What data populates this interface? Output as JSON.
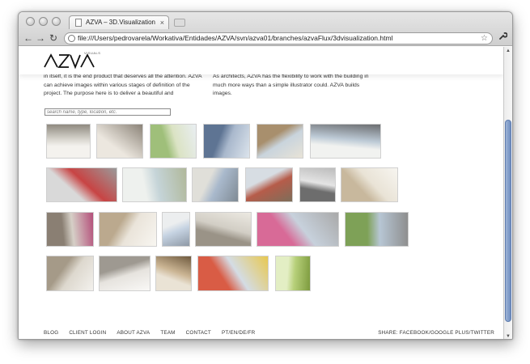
{
  "browser": {
    "tab_title": "AZVA – 3D.Visualization",
    "tab_close": "×",
    "back_glyph": "←",
    "forward_glyph": "→",
    "reload_glyph": "↻",
    "url": "file:///Users/pedrovarela/Workativa/Entidades/AZVA/svn/azva01/branches/azvaFlux/3dvisualization.html",
    "star_glyph": "☆",
    "wrench_glyph": "🔧",
    "scroll_up": "▲",
    "scroll_down": "▼"
  },
  "site": {
    "logo_text": "AZVA",
    "logo_sub": "VISUALS",
    "intro_left": "in itself, it is the end product that deserves all the attention. AZVA can achieve images within various stages of definition of the project. The purpose here is to deliver a beautiful and",
    "intro_right": "As architects, AZVA has the flexibility to work with the building in much more ways than a simple illustrator could. AZVA builds images.",
    "search_placeholder": "search name, type, location, etc.",
    "footer_links": [
      "BLOG",
      "CLIENT LOGIN",
      "ABOUT AZVA",
      "TEAM",
      "CONTACT",
      "PT/EN/DE/FR"
    ],
    "share_text": "SHARE: FACEBOOK/GOOGLE PLUS/TWITTER"
  },
  "gallery": [
    {
      "name": "interior-balcony",
      "colors": [
        "#d9d6cf",
        "#f4f2ee",
        "#8f8a80"
      ]
    },
    {
      "name": "interior-dining",
      "colors": [
        "#cfc9c0",
        "#ece7df",
        "#8b8378"
      ]
    },
    {
      "name": "green-building",
      "colors": [
        "#dbe3c4",
        "#9fbf7a",
        "#e9eef2"
      ]
    },
    {
      "name": "blue-facade",
      "colors": [
        "#a9b8cc",
        "#5e7493",
        "#dce4ec"
      ]
    },
    {
      "name": "street-people",
      "colors": [
        "#c9d4dd",
        "#a88f6d",
        "#e8e3d7"
      ]
    },
    {
      "name": "white-villa-woman",
      "colors": [
        "#bdcad6",
        "#f1f2f0",
        "#6b6d70"
      ]
    },
    {
      "name": "red-interior",
      "colors": [
        "#c84444",
        "#d9d9d9",
        "#9a9a9a"
      ]
    },
    {
      "name": "aerial-landscape",
      "colors": [
        "#c5d4d8",
        "#eef1ee",
        "#b0b89a"
      ]
    },
    {
      "name": "tower-block",
      "colors": [
        "#a9b9cc",
        "#e0dfd9",
        "#7f8a94"
      ]
    },
    {
      "name": "red-brick-building",
      "colors": [
        "#b65c4a",
        "#d7dde3",
        "#7d6e5a"
      ]
    },
    {
      "name": "wireframe-model",
      "colors": [
        "#e4e4e4",
        "#6d6d6d",
        "#bcbcbc"
      ]
    },
    {
      "name": "bright-interior",
      "colors": [
        "#e9e3d6",
        "#c8b89d",
        "#f7f5f0"
      ]
    },
    {
      "name": "woman-atrium",
      "colors": [
        "#d6d0c7",
        "#8a7f73",
        "#b44f7a"
      ]
    },
    {
      "name": "curved-ceiling",
      "colors": [
        "#eae4da",
        "#bba98e",
        "#f8f6f1"
      ]
    },
    {
      "name": "highrise",
      "colors": [
        "#c6d3e2",
        "#eceeef",
        "#8e99a6"
      ]
    },
    {
      "name": "concrete-hall",
      "colors": [
        "#d2cec5",
        "#9a9387",
        "#ece9e2"
      ]
    },
    {
      "name": "pink-street",
      "colors": [
        "#c7d1dc",
        "#d86a97",
        "#a9a9a9"
      ]
    },
    {
      "name": "green-plaza",
      "colors": [
        "#b7c6d4",
        "#7ea157",
        "#8e8e8e"
      ]
    },
    {
      "name": "white-corridor",
      "colors": [
        "#ddd8ce",
        "#a59a88",
        "#f3f1ed"
      ]
    },
    {
      "name": "white-sculpture",
      "colors": [
        "#e6e3de",
        "#9e9991",
        "#f9f8f6"
      ]
    },
    {
      "name": "wood-interior",
      "colors": [
        "#cbb594",
        "#eae3d5",
        "#6f5a3e"
      ]
    },
    {
      "name": "playground",
      "colors": [
        "#d4dce4",
        "#d95c45",
        "#e8c84f"
      ]
    },
    {
      "name": "green-corridor",
      "colors": [
        "#b7d07a",
        "#e3eec4",
        "#7d9b3e"
      ]
    }
  ]
}
